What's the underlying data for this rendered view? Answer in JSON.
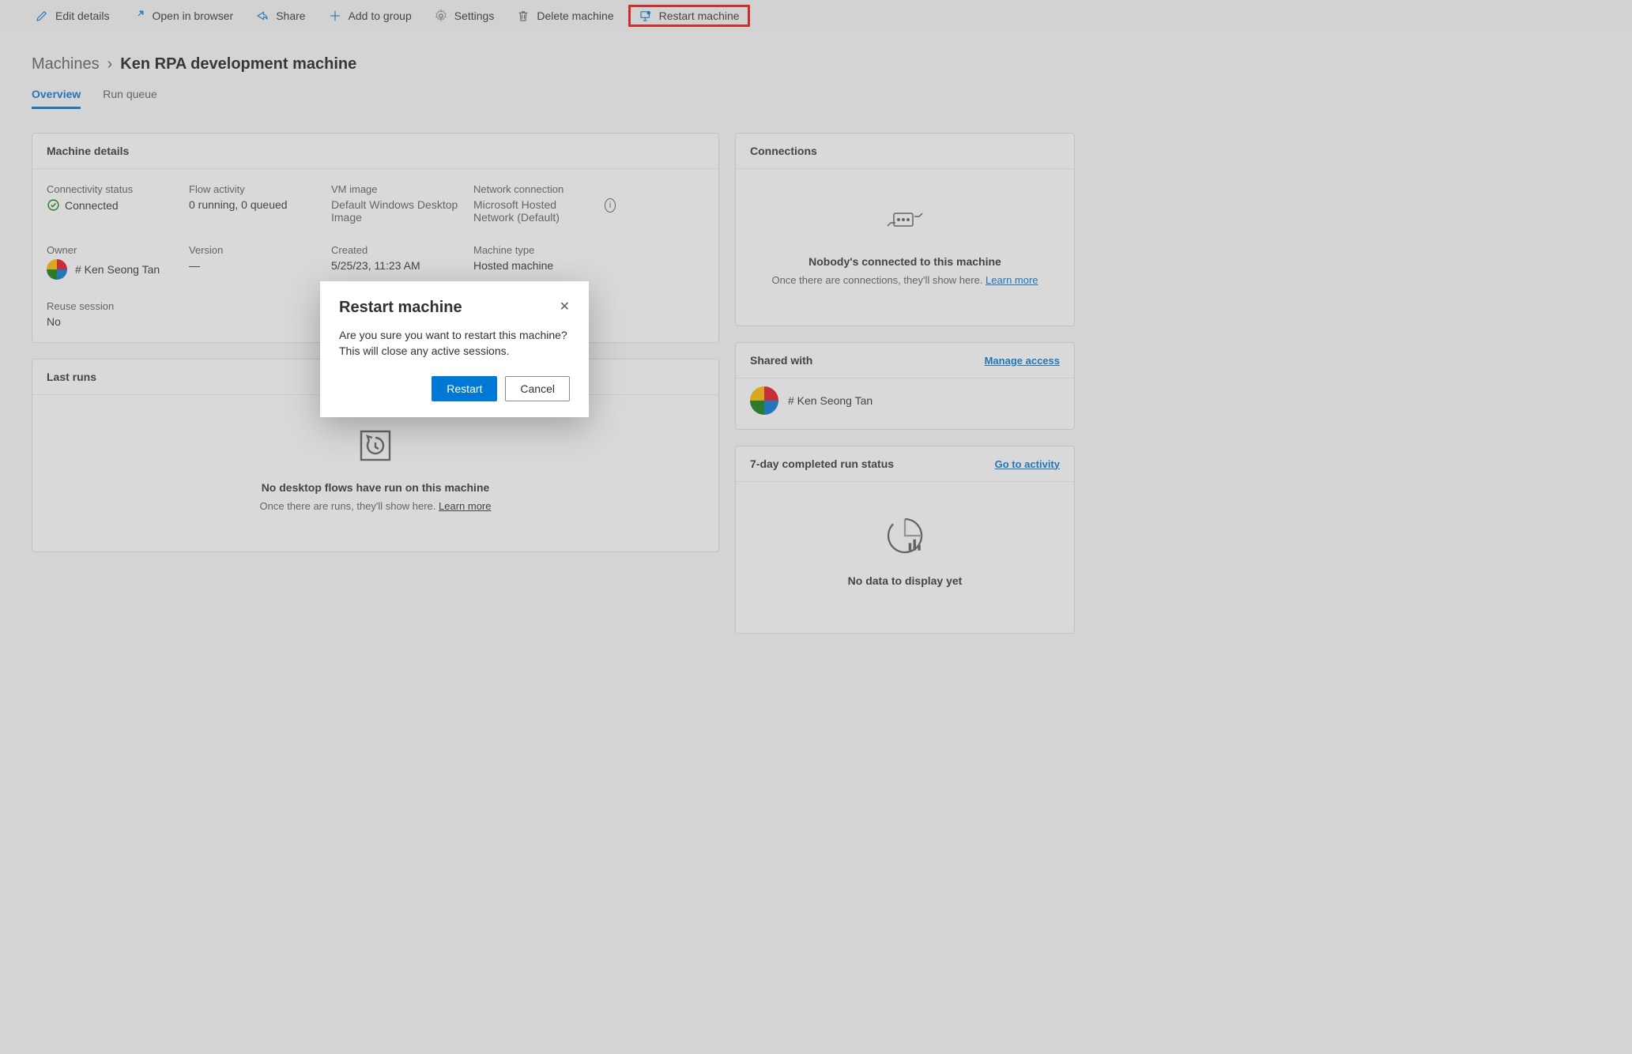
{
  "toolbar": {
    "edit_details": "Edit details",
    "open_in_browser": "Open in browser",
    "share": "Share",
    "add_to_group": "Add to group",
    "settings": "Settings",
    "delete_machine": "Delete machine",
    "restart_machine": "Restart machine"
  },
  "breadcrumb": {
    "root": "Machines",
    "current": "Ken RPA development machine"
  },
  "tabs": {
    "overview": "Overview",
    "run_queue": "Run queue"
  },
  "machine_details": {
    "title": "Machine details",
    "connectivity_label": "Connectivity status",
    "connectivity_value": "Connected",
    "flow_activity_label": "Flow activity",
    "flow_activity_value": "0 running, 0 queued",
    "vm_image_label": "VM image",
    "vm_image_value": "Default Windows Desktop Image",
    "network_label": "Network connection",
    "network_value": "Microsoft Hosted Network (Default)",
    "owner_label": "Owner",
    "owner_value": "# Ken Seong Tan",
    "version_label": "Version",
    "version_value": "—",
    "created_label": "Created",
    "created_value": "5/25/23, 11:23 AM",
    "machine_type_label": "Machine type",
    "machine_type_value": "Hosted machine",
    "reuse_label": "Reuse session",
    "reuse_value": "No"
  },
  "last_runs": {
    "title": "Last runs",
    "empty_headline": "No desktop flows have run on this machine",
    "empty_sub": "Once there are runs, they'll show here. ",
    "learn_more": "Learn more"
  },
  "connections": {
    "title": "Connections",
    "empty_headline": "Nobody's connected to this machine",
    "empty_sub": "Once there are connections, they'll show here. ",
    "learn_more": "Learn more"
  },
  "shared": {
    "title": "Shared with",
    "manage": "Manage access",
    "person": "# Ken Seong Tan"
  },
  "run_status": {
    "title": "7-day completed run status",
    "link": "Go to activity",
    "empty": "No data to display yet"
  },
  "dialog": {
    "title": "Restart machine",
    "body": "Are you sure you want to restart this machine? This will close any active sessions.",
    "confirm": "Restart",
    "cancel": "Cancel"
  }
}
